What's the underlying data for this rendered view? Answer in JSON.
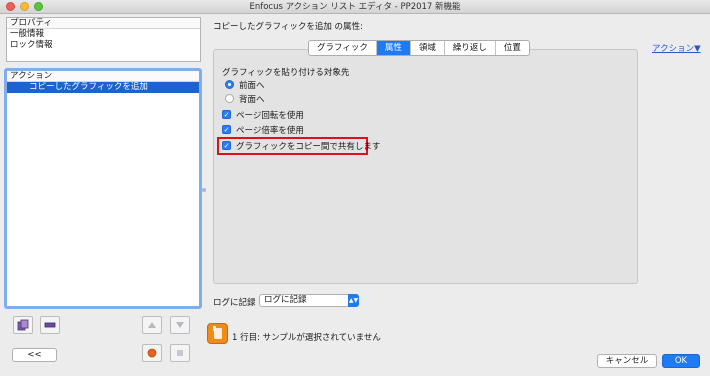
{
  "window": {
    "title": "Enfocus アクション リスト エディタ - PP2017 新機能"
  },
  "properties_panel": {
    "header": "プロパティ",
    "items": [
      "一般情報",
      "ロック情報"
    ]
  },
  "actions_panel": {
    "header": "アクション",
    "selected_item": "コピーしたグラフィックを追加"
  },
  "left_toolbar": {
    "back_label": "<<",
    "icons": [
      "add-action-icon",
      "remove-action-icon",
      "move-up-icon",
      "move-down-icon",
      "record-icon",
      "stop-icon"
    ]
  },
  "main": {
    "section_title": "コピーしたグラフィックを追加 の属性:",
    "action_link": "アクション▼",
    "tabs": [
      {
        "label": "グラフィック",
        "active": false
      },
      {
        "label": "属性",
        "active": true
      },
      {
        "label": "領域",
        "active": false
      },
      {
        "label": "繰り返し",
        "active": false
      },
      {
        "label": "位置",
        "active": false
      }
    ],
    "target_label": "グラフィックを貼り付ける対象先",
    "radio_front": "前面へ",
    "radio_back": "背面へ",
    "check_rotation": "ページ回転を使用",
    "check_scale": "ページ倍率を使用",
    "check_share": "グラフィックをコピー間で共有します",
    "log_label": "ログに記録",
    "log_value": "ログに記録",
    "status_message": "1 行目: サンプルが選択されていません"
  },
  "footer": {
    "cancel_label": "キャンセル",
    "ok_label": "OK"
  },
  "colors": {
    "accent": "#1e7bf3",
    "selection": "#1e62d0",
    "highlight_border": "#d8141a"
  }
}
